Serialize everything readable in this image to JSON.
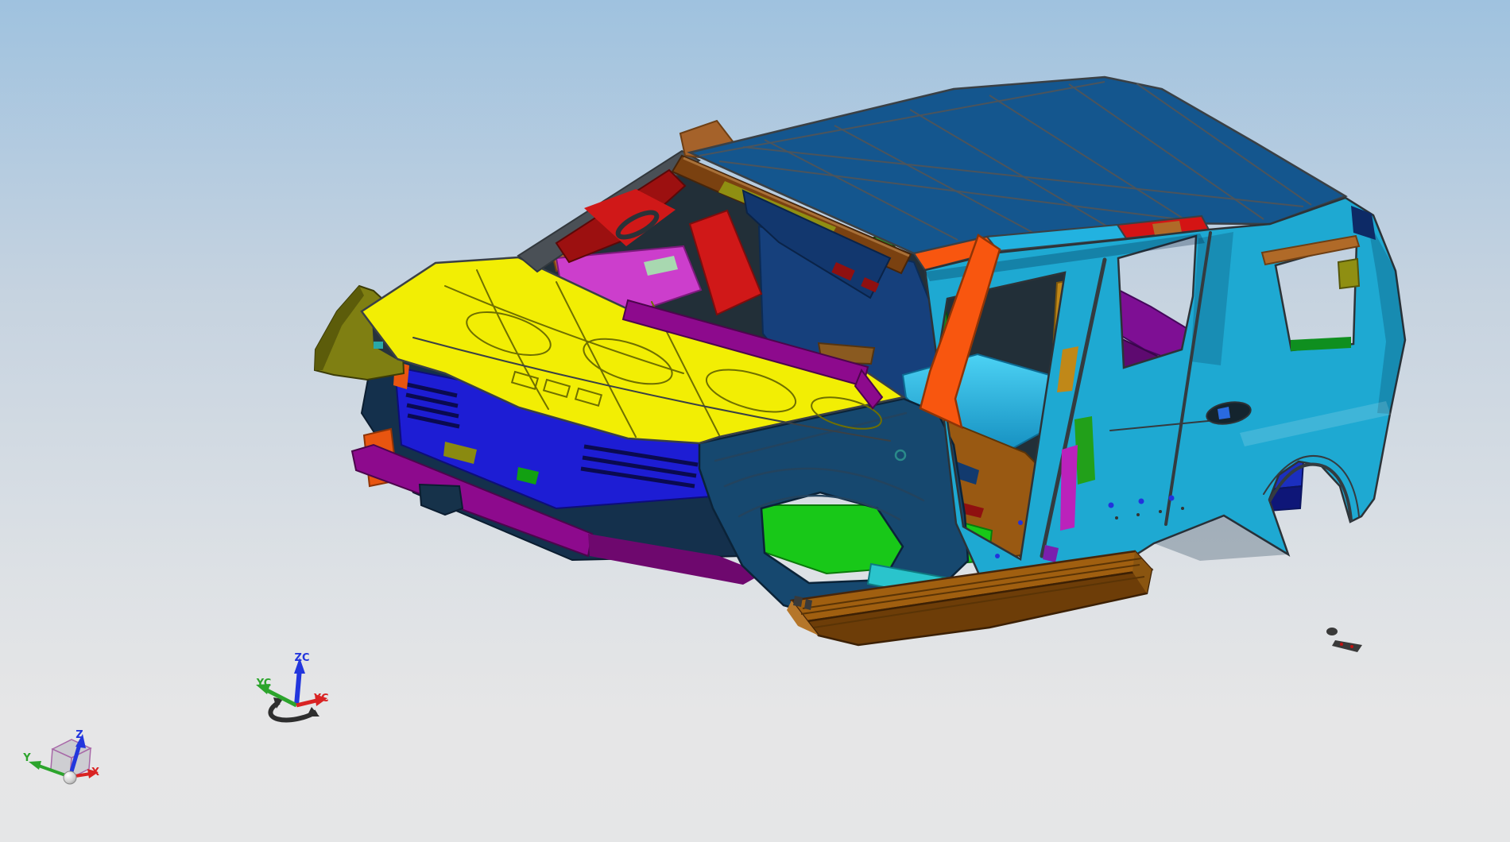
{
  "scene": {
    "background_top": "#9fc2df",
    "background_mid": "#c6d3e0",
    "background_low": "#dde1e5",
    "background_bottom": "#e6e6e7",
    "edge_color": "#3a4045",
    "window_sky": "#c8d5e2"
  },
  "wcs_triad": {
    "z_label": "ZC",
    "y_label": "YC",
    "x_label": "XC",
    "z_color": "#2336dd",
    "y_color": "#2ca42c",
    "x_color": "#d92323",
    "handle_color": "#2e2e2e"
  },
  "abs_triad": {
    "z_label": "Z",
    "y_label": "Y",
    "x_label": "X",
    "z_color": "#2336dd",
    "y_color": "#2ca42c",
    "x_color": "#d92323",
    "cube_edge_color": "#a868a8",
    "sphere_color": "#c9c9c9"
  },
  "model": {
    "colors": {
      "roof": "#14568e",
      "roof_line": "#4b545c",
      "header_brown": "#7a4110",
      "header_olive": "#8f8f12",
      "rail_gray": "#4a5056",
      "rail_red_inner": "#9c1010",
      "red_bright": "#d01818",
      "copper": "#a5622a",
      "hood": "#f2ee04",
      "hood_line": "#6f6f00",
      "cowl_olive": "#7f7f12",
      "magenta_cowl": "#cc3ecc",
      "magenta_bar": "#8d0a8d",
      "radiator_blue": "#1d1dd4",
      "structure_navy": "#14304c",
      "horn_orange": "#e85510",
      "floor_green": "#18c818",
      "fender_navy": "#16486f",
      "body_cyan": "#1ea9d2",
      "rocker_cyan": "#2ac4cc",
      "board_top": "#a05f10",
      "board_side": "#6d3d08",
      "pillar_orange": "#f8560f",
      "rail_cyan": "#22b2e0",
      "rail_red": "#d41414",
      "gold": "#c08818",
      "pillar_green": "#22a01a",
      "pillar_magenta": "#bb22bb",
      "trim_purple": "#7e0f94",
      "trim_purple_dark": "#5e0a70",
      "floor_cyan": "#36c6ec",
      "floor_brown": "#995912",
      "seat_green": "#1f9a28",
      "dash_blue": "#16407c",
      "wheelhouse_blue": "#1b2fbf",
      "wheelhouse_dark": "#0e1678",
      "dpillar_navy": "#0d2a66",
      "debris_gray": "#3a3a3a"
    }
  }
}
